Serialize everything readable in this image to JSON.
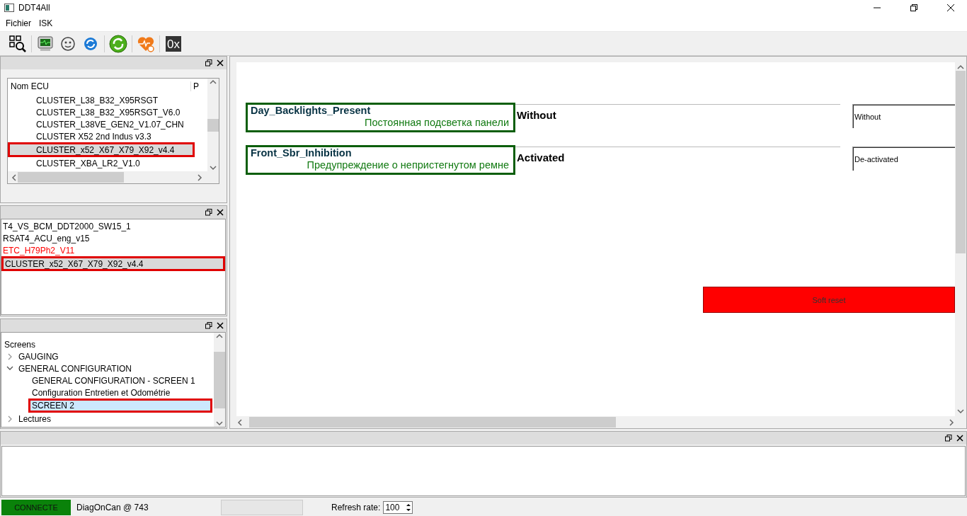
{
  "window": {
    "title": "DDT4All"
  },
  "menu": [
    "Fichier",
    "ISK"
  ],
  "toolbar": [
    {
      "kind": "qr-search"
    },
    {
      "kind": "monitor"
    },
    {
      "kind": "head"
    },
    {
      "kind": "refresh-blue"
    },
    {
      "kind": "refresh-green"
    },
    {
      "kind": "heart"
    },
    {
      "kind": "text",
      "label": "0x"
    }
  ],
  "ecu_list": {
    "columns": [
      "Nom ECU",
      "P"
    ],
    "rows": [
      {
        "name": "CLUSTER_L38_B32_X95RSGT",
        "selected": false
      },
      {
        "name": "CLUSTER_L38_B32_X95RSGT_V6.0",
        "selected": false
      },
      {
        "name": "CLUSTER_L38VE_GEN2_V1.07_CHN",
        "selected": false
      },
      {
        "name": "CLUSTER X52 2nd Indus v3.3",
        "selected": false
      },
      {
        "name": "CLUSTER_x52_X67_X79_X92_v4.4",
        "selected": true
      },
      {
        "name": "CLUSTER_XBA_LR2_V1.0",
        "selected": false
      }
    ]
  },
  "loaded_ecus": [
    {
      "name": "T4_VS_BCM_DDT2000_SW15_1",
      "color": "#000000",
      "selected": false
    },
    {
      "name": "RSAT4_ACU_eng_v15",
      "color": "#000000",
      "selected": false
    },
    {
      "name": "ETC_H79Ph2_V11",
      "color": "#ff0000",
      "selected": false
    },
    {
      "name": "CLUSTER_x52_X67_X79_X92_v4.4",
      "color": "#000000",
      "selected": true
    }
  ],
  "screens": {
    "title": "Screens",
    "items": [
      {
        "label": "GAUGING",
        "expanded": false,
        "selected": false
      },
      {
        "label": "GENERAL CONFIGURATION",
        "expanded": true,
        "selected": false,
        "children": [
          {
            "label": "GENERAL CONFIGURATION - SCREEN 1",
            "selected": false
          },
          {
            "label": "Configuration Entretien et Odométrie",
            "selected": false
          },
          {
            "label": "SCREEN 2",
            "selected": true
          }
        ]
      },
      {
        "label": "Lectures",
        "expanded": false,
        "selected": false
      }
    ]
  },
  "parameters": [
    {
      "name": "Day_Backlights_Present",
      "description": "Постоянная подсветка панели",
      "value": "Without",
      "choice": "Without"
    },
    {
      "name": "Front_Sbr_Inhibition",
      "description": "Предупреждение о непристегнутом ремне",
      "value": "Activated",
      "choice": "De-activated"
    }
  ],
  "soft_reset": {
    "label": "Soft reset"
  },
  "status_bar": {
    "connection": "CONNECTE",
    "connected": true,
    "interface": "DiagOnCan @ 743",
    "refresh_label": "Refresh rate:",
    "refresh_value": "100"
  }
}
